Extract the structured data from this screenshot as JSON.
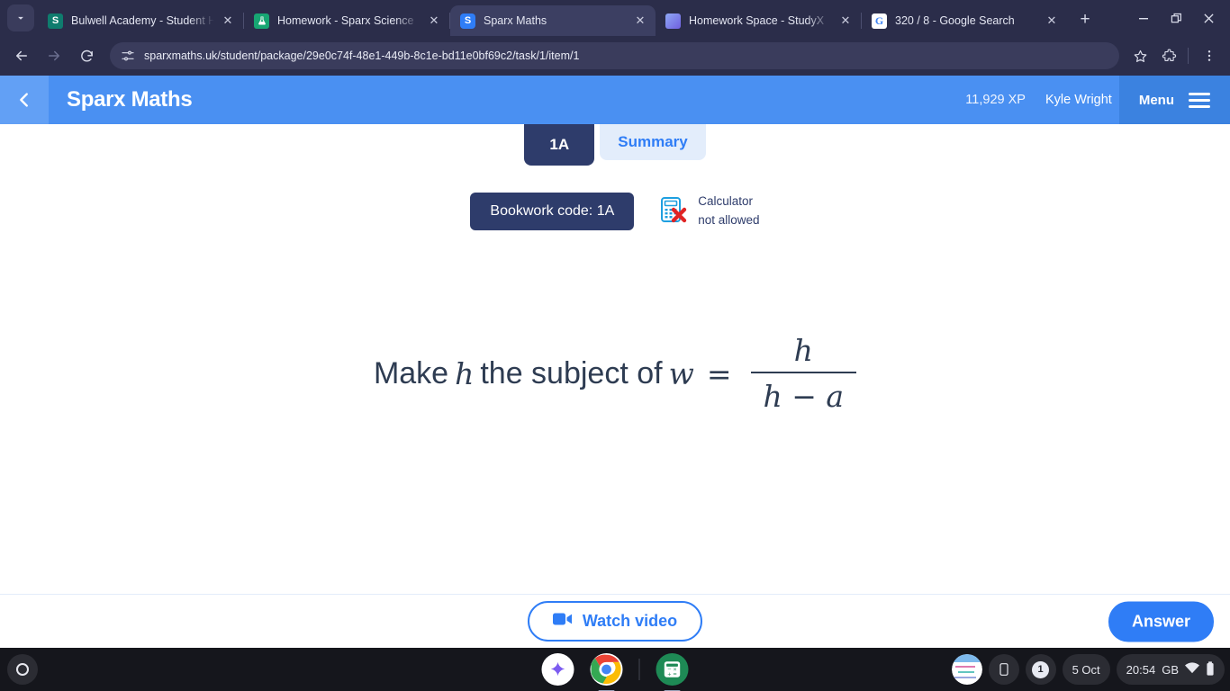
{
  "browser": {
    "tab_search_icon": "chevron-down-icon",
    "tabs": [
      {
        "title": "Bulwell Academy - Student Ho",
        "favicon": "sharepoint-icon",
        "favicon_letter": "S",
        "active": false
      },
      {
        "title": "Homework - Sparx Science",
        "favicon": "flask-icon",
        "favicon_letter": "⚗",
        "active": false
      },
      {
        "title": "Sparx Maths",
        "favicon": "sparx-maths-icon",
        "favicon_letter": "S",
        "active": true
      },
      {
        "title": "Homework Space - StudyX",
        "favicon": "studyx-icon",
        "favicon_letter": "",
        "active": false
      },
      {
        "title": "320 / 8 - Google Search",
        "favicon": "google-icon",
        "favicon_letter": "G",
        "active": false
      }
    ],
    "new_tab_label": "+",
    "close_label": "✕",
    "window_minimize": "minimize-icon",
    "window_restore": "restore-icon",
    "window_close": "close-icon",
    "toolbar": {
      "back": "back-arrow-icon",
      "forward": "forward-arrow-icon",
      "reload": "reload-icon",
      "site_info": "site-settings-icon",
      "url": "sparxmaths.uk/student/package/29e0c74f-48e1-449b-8c1e-bd11e0bf69c2/task/1/item/1",
      "bookmark": "star-icon",
      "extensions": "puzzle-piece-icon",
      "menu": "three-dot-menu-icon"
    }
  },
  "app": {
    "header": {
      "back_icon": "chevron-left-icon",
      "brand": "Sparx Maths",
      "xp": "11,929 XP",
      "username": "Kyle Wright",
      "menu_label": "Menu",
      "menu_icon": "hamburger-icon",
      "bg_color": "#4a90f2",
      "menu_bg_color": "#3b82e0",
      "back_bg_color": "#62a0f5"
    },
    "tabs": [
      {
        "label": "1A",
        "active": true
      },
      {
        "label": "Summary",
        "active": false
      }
    ],
    "bookwork_code": "Bookwork code: 1A",
    "calculator": {
      "icon": "calculator-not-allowed-icon",
      "line1": "Calculator",
      "line2": "not allowed"
    },
    "question": {
      "prefix": "Make",
      "var_subject": "h",
      "middle": "the subject of",
      "lhs": "w",
      "equals": "=",
      "fraction_numerator": "h",
      "fraction_denominator": "h − a",
      "full_text": "Make h the subject of w = h / (h − a)"
    },
    "footer": {
      "watch_video_label": "Watch video",
      "watch_video_icon": "video-camera-icon",
      "answer_label": "Answer",
      "accent_color": "#2f7df6"
    }
  },
  "shelf": {
    "launcher_icon": "launcher-circle-icon",
    "apps": [
      {
        "name": "gemini-app-icon",
        "label": "Gemini",
        "running": false
      },
      {
        "name": "chrome-app-icon",
        "label": "Google Chrome",
        "running": true
      },
      {
        "name": "calculator-app-icon",
        "label": "Calculator",
        "running": true
      }
    ],
    "tray": {
      "window_preview": "window-preview-thumbnail",
      "phone_hub_icon": "phone-hub-icon",
      "notification_count": "1",
      "date": "5 Oct",
      "time": "20:54",
      "locale": "GB",
      "wifi_icon": "wifi-icon",
      "battery_icon": "battery-icon"
    }
  }
}
